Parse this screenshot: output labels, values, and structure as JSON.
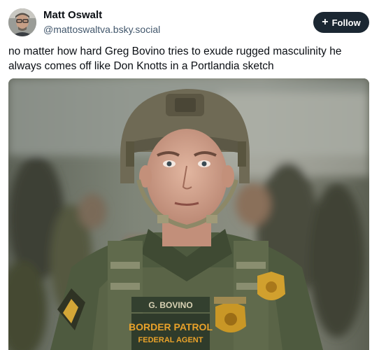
{
  "author": {
    "name": "Matt Oswalt",
    "handle": "@mattoswaltva.bsky.social"
  },
  "follow_button": {
    "icon": "plus-icon",
    "label": "Follow"
  },
  "post": {
    "text_line1": "no matter how hard Greg Bovino tries to exude rugged masculinity he",
    "text_line2": "always comes off like Don Knotts in a Portlandia sketch"
  },
  "media": {
    "name_tape": "G. BOVINO",
    "patch_line1": "BORDER PATROL",
    "patch_line2": "FEDERAL AGENT"
  },
  "colors": {
    "follow_bg": "#1b2732",
    "handle": "#42576c",
    "uniform": "#4e5a3f",
    "helmet": "#6f6a55",
    "patch_text": "#e9a22a"
  }
}
